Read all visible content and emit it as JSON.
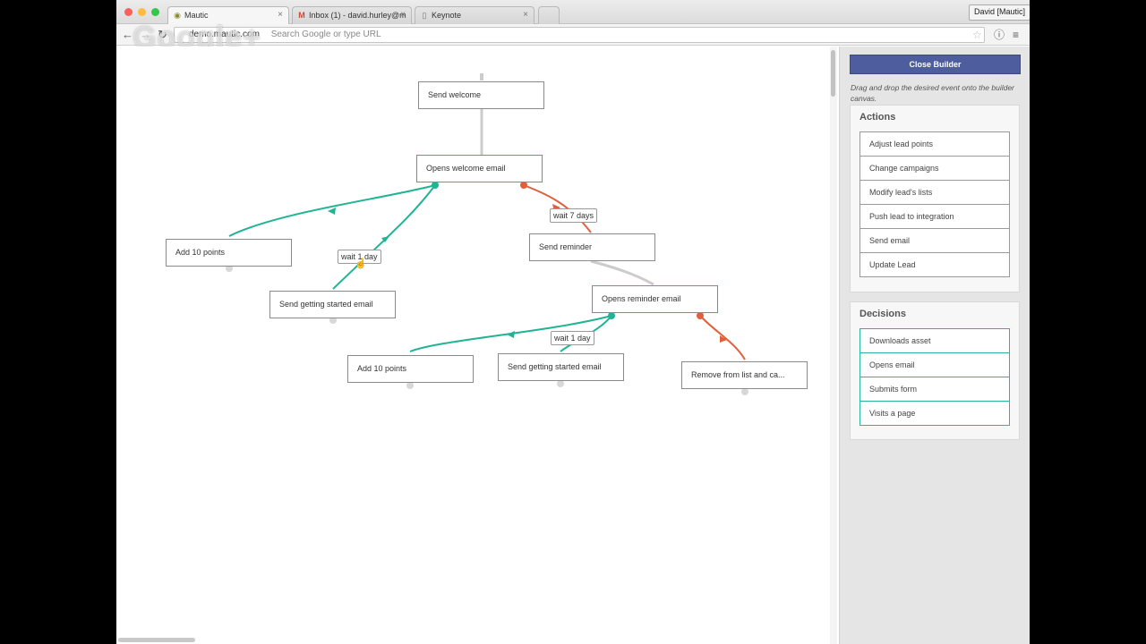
{
  "browser": {
    "tabs": [
      {
        "title": "Mautic",
        "favicon": "mautic-icon"
      },
      {
        "title": "Inbox (1) - david.hurley@m",
        "favicon": "gmail-icon"
      },
      {
        "title": "Keynote",
        "favicon": "page-icon"
      }
    ],
    "profile_label": "David [Mautic]",
    "url": "demo.mautic.com",
    "search_placeholder": "Search Google or type URL",
    "overlay_watermark": "Google+"
  },
  "campaign_canvas": {
    "nodes": [
      {
        "id": "n1",
        "label": "Send welcome",
        "kind": "action"
      },
      {
        "id": "n2",
        "label": "Opens welcome email",
        "kind": "decision"
      },
      {
        "id": "n3",
        "label": "Add 10 points",
        "kind": "action"
      },
      {
        "id": "n4",
        "label": "Send getting started email",
        "kind": "action"
      },
      {
        "id": "n5",
        "label": "Send reminder",
        "kind": "action"
      },
      {
        "id": "n6",
        "label": "Opens reminder email",
        "kind": "decision"
      },
      {
        "id": "n7",
        "label": "Add 10 points",
        "kind": "action"
      },
      {
        "id": "n8",
        "label": "Send getting started email",
        "kind": "action"
      },
      {
        "id": "n9",
        "label": "Remove from list and ca...",
        "kind": "action"
      }
    ],
    "connection_labels": [
      "wait 1 day",
      "wait 7 days",
      "wait 1 day"
    ],
    "colors": {
      "yes_path": "#20b395",
      "no_path": "#e0603c",
      "neutral_path": "#cccccc"
    }
  },
  "builder_panel": {
    "close_label": "Close Builder",
    "hint": "Drag and drop the desired event onto the builder canvas.",
    "actions_title": "Actions",
    "actions": [
      "Adjust lead points",
      "Change campaigns",
      "Modify lead's lists",
      "Push lead to integration",
      "Send email",
      "Update Lead"
    ],
    "decisions_title": "Decisions",
    "decisions": [
      "Downloads asset",
      "Opens email",
      "Submits form",
      "Visits a page"
    ]
  }
}
